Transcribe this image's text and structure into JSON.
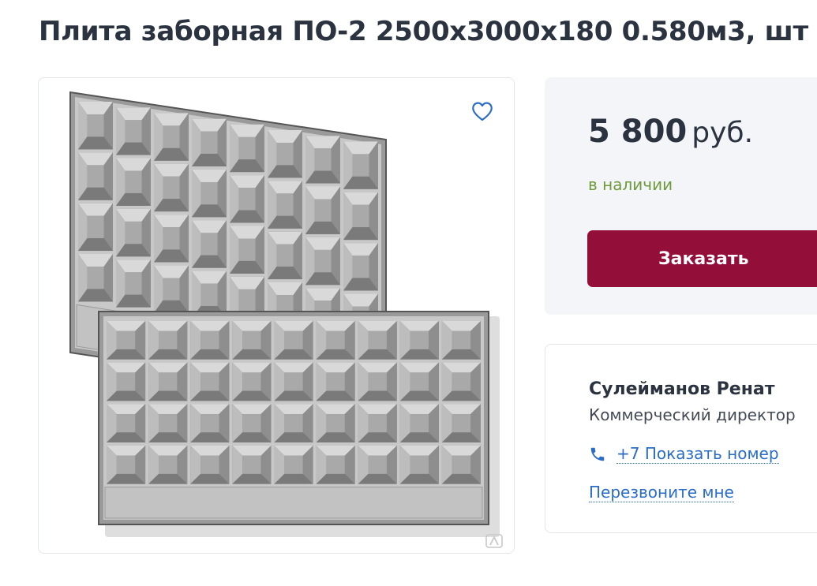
{
  "product": {
    "title": "Плита заборная ПО-2 2500х3000х180 0.580м3, шт",
    "image_alt": "Плита заборная ПО-2"
  },
  "gallery": {
    "favorite_icon": "heart-outline-icon",
    "watermark_icon": "site-logo-watermark-icon"
  },
  "offer": {
    "price": "5 800",
    "currency": "руб.",
    "availability": "в наличии",
    "order_label": "Заказать"
  },
  "contact": {
    "name": "Сулейманов Ренат",
    "position": "Коммерческий директор",
    "phone_icon": "phone-icon",
    "phone_label": "+7 Показать номер",
    "callback_label": "Перезвоните мне"
  },
  "colors": {
    "title": "#2b3340",
    "stock_green": "#6f9a3c",
    "order_button": "#930f3a",
    "link_blue": "#2a6cc7",
    "card_bg": "#f4f5f8"
  }
}
